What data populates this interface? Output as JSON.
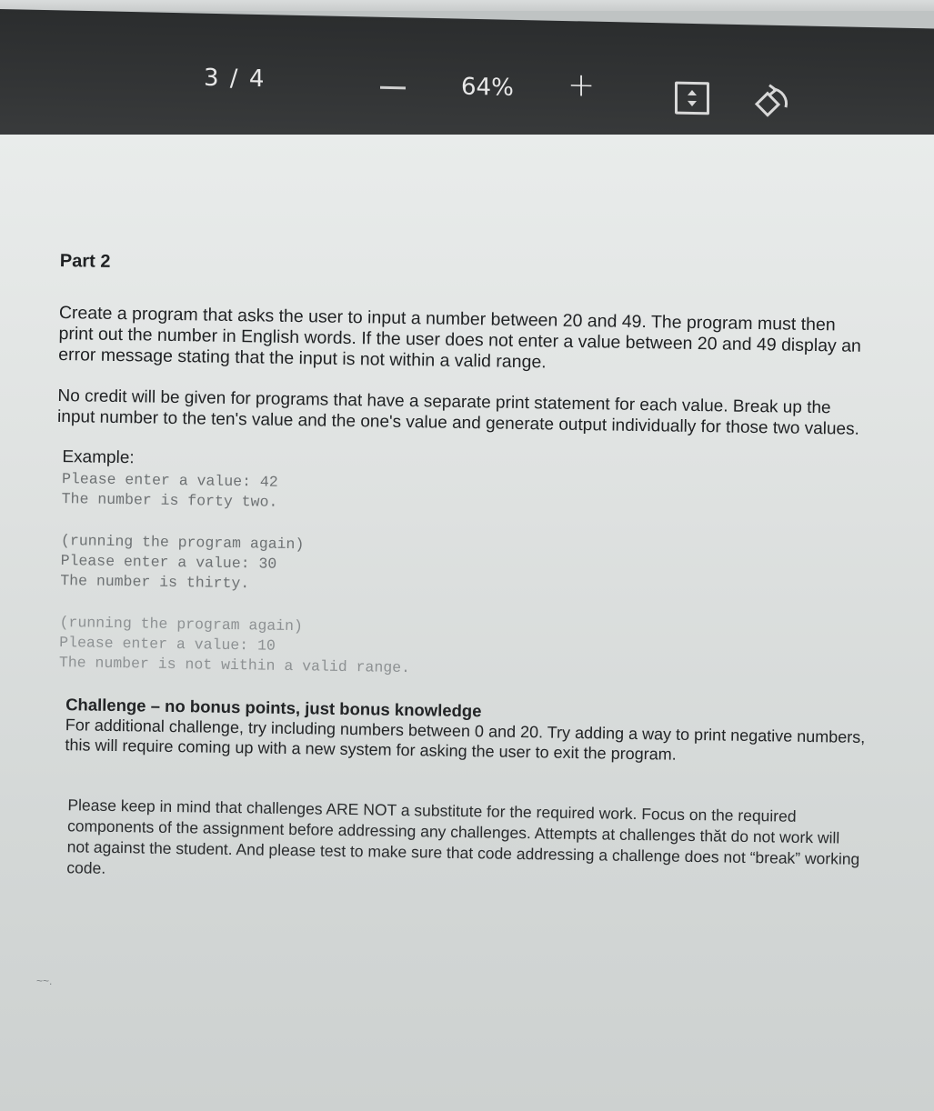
{
  "toolbar": {
    "page_indicator": "3 / 4",
    "zoom_level": "64%",
    "zoom_out_icon": "minus-icon",
    "zoom_in_label": "+",
    "fit_icon": "fit-to-page-icon",
    "rotate_icon": "rotate-icon"
  },
  "document": {
    "heading": "Part 2",
    "paragraph1": "Create a program that asks the user to input a number between 20 and 49. The program must then print out the number in English words. If the user does not enter a value between 20 and 49 display an error message stating that the input is not within a valid range.",
    "paragraph2": "No credit will be given for programs that have a separate print statement for each value. Break up the input number to the ten's value and the one's value and generate output individually for those two values.",
    "example_label": "Example:",
    "example1": [
      "Please enter a value: 42",
      "The number is forty two."
    ],
    "example2": [
      "(running the program again)",
      "Please enter a value: 30",
      "The number is thirty."
    ],
    "example3": [
      "(running the program again)",
      "Please enter a value: 10",
      "The number is not within a valid range."
    ],
    "challenge_title": "Challenge – no bonus points, just bonus knowledge",
    "challenge_text": "For additional challenge, try including numbers between 0 and 20. Try adding a way to print negative numbers, this will require coming up with a new system for asking the user to exit the program.",
    "note": "Please keep in mind that challenges ARE NOT a substitute for the required work. Focus on the required components of the assignment before addressing any challenges. Attempts at challenges thăt do not work will not against the student. And please test to make sure that code addressing a challenge does not “break” working code.",
    "stray_mark": "~~."
  },
  "colors": {
    "toolbar_bg": "#333536",
    "page_bg": "#e3e6e5",
    "text": "#202224",
    "code_text": "#6d7173"
  }
}
